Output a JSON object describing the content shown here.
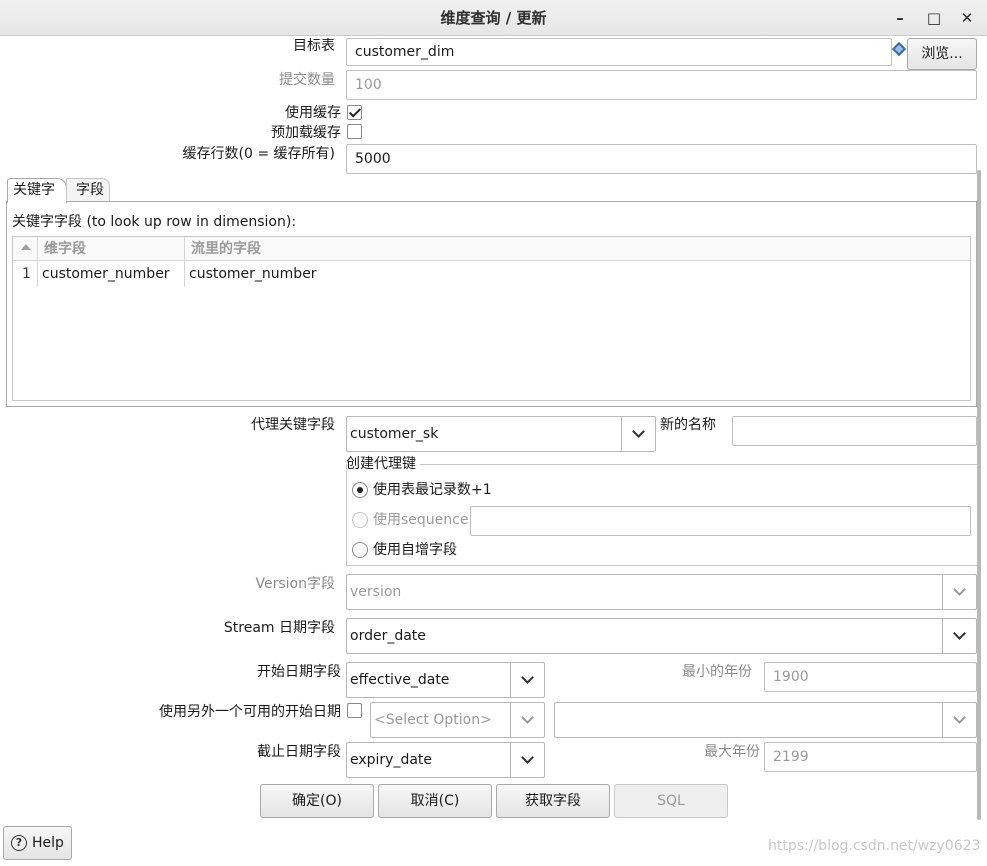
{
  "window": {
    "title": "维度查询 / 更新",
    "minimize": "–",
    "maximize": "□",
    "close": "✕"
  },
  "top": {
    "target_table_label": "目标表",
    "target_table_value": "customer_dim",
    "browse_label": "浏览...",
    "commit_size_label": "提交数量",
    "commit_size_value": "100",
    "use_cache_label": "使用缓存",
    "preload_cache_label": "预加载缓存",
    "cache_rows_label": "缓存行数(0 = 缓存所有)",
    "cache_rows_value": "5000"
  },
  "tabs": [
    {
      "label": "关键字"
    },
    {
      "label": "字段"
    }
  ],
  "keys": {
    "section_label": "关键字字段 (to look up row in dimension):",
    "col_dim_field": "维字段",
    "col_stream_field": "流里的字段",
    "rows": [
      {
        "num": "1",
        "dim_field": "customer_number",
        "stream_field": "customer_number"
      }
    ]
  },
  "form": {
    "tk_label": "代理关键字段",
    "tk_value": "customer_sk",
    "new_name_label": "新的名称",
    "new_name_value": "",
    "create_key_group": "创建代理键",
    "radio_table_max": "使用表最记录数+1",
    "radio_sequence": "使用sequence",
    "sequence_value": "",
    "radio_auto_inc": "使用自增字段",
    "version_label": "Version字段",
    "version_value": "version",
    "stream_date_label": "Stream 日期字段",
    "stream_date_value": "order_date",
    "start_date_label": "开始日期字段",
    "start_date_value": "effective_date",
    "min_year_label": "最小的年份",
    "min_year_value": "1900",
    "alt_start_label": "使用另外一个可用的开始日期",
    "alt_start_select": "<Select Option>",
    "alt_start_field": "",
    "end_date_label": "截止日期字段",
    "end_date_value": "expiry_date",
    "max_year_label": "最大年份",
    "max_year_value": "2199"
  },
  "buttons": {
    "ok": "确定(O)",
    "cancel": "取消(C)",
    "get_fields": "获取字段",
    "sql": "SQL"
  },
  "help_label": "Help",
  "watermark": "https://blog.csdn.net/wzy0623"
}
